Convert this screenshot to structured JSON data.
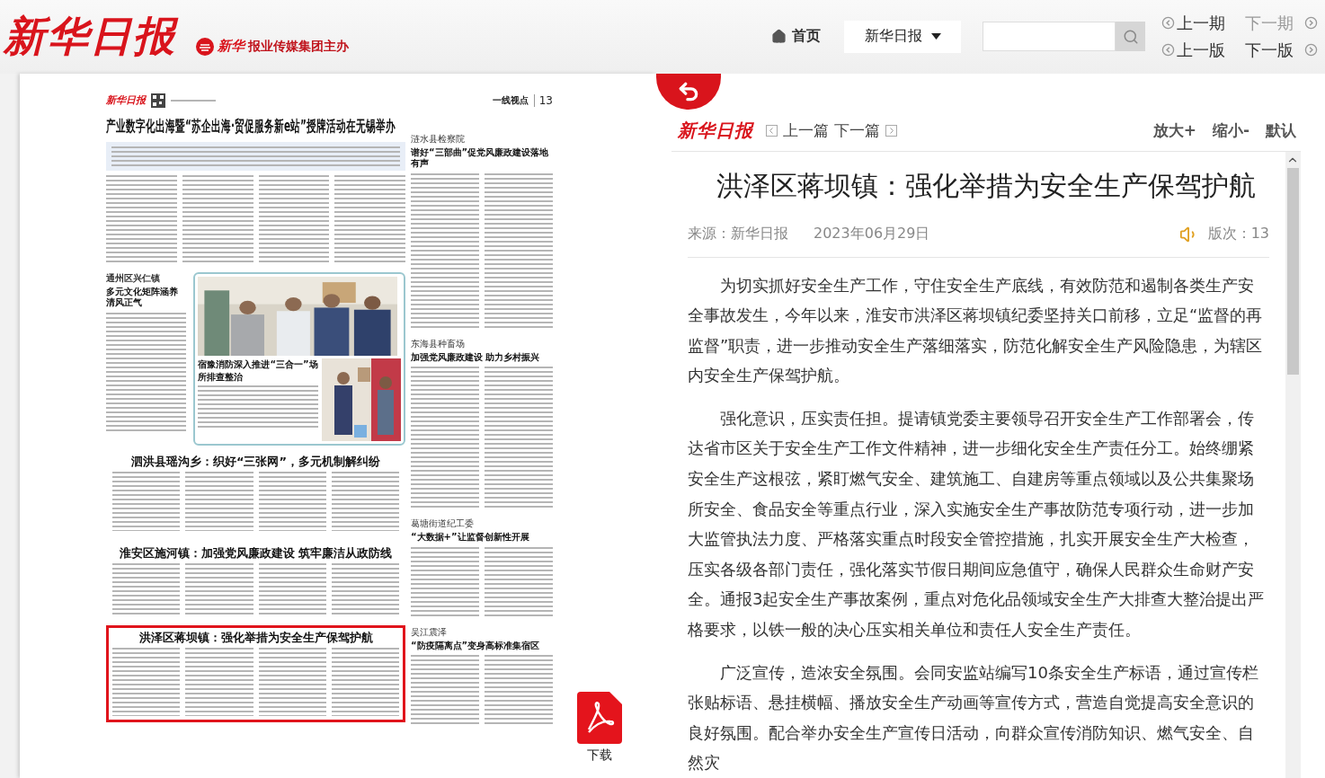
{
  "header": {
    "logo": "新华日报",
    "publisher_mark": "新华",
    "publisher": "报业传媒集团主办",
    "home": "首页",
    "edition_select": "新华日报",
    "issue_links": [
      {
        "label": "上一期",
        "kind": "prev",
        "disabled": false
      },
      {
        "label": "下一期",
        "kind": "next",
        "disabled": true
      },
      {
        "label": "上一版",
        "kind": "prev",
        "disabled": false
      },
      {
        "label": "下一版",
        "kind": "next",
        "disabled": false
      }
    ]
  },
  "newspaper_page": {
    "masthead": "新华日报",
    "section": "一线视点",
    "page_number": "13",
    "lead_headline": "产业数字化出海暨“苏企出海·贸促服务新e站”授牌活动在无锡举办",
    "side_story": {
      "kicker": "通州区兴仁镇",
      "headline": "多元文化矩阵涵养清风正气"
    },
    "photo_caption": "宿豫消防深入推进“三合一”场所排查整治",
    "stories": [
      {
        "headline": "泗洪县瑶沟乡：织好“三张网”，多元机制解纠纷",
        "highlighted": false
      },
      {
        "headline": "淮安区施河镇：加强党风廉政建设  筑牢廉洁从政防线",
        "highlighted": false
      },
      {
        "headline": "洪泽区蒋坝镇：强化举措为安全生产保驾护航",
        "highlighted": true
      }
    ],
    "right_column": [
      {
        "kicker": "涟水县检察院",
        "headline": "谱好“三部曲”促党风廉政建设落地有声"
      },
      {
        "kicker": "东海县种畜场",
        "headline": "加强党风廉政建设  助力乡村振兴"
      },
      {
        "kicker": "葛塘街道纪工委",
        "headline": "“大数据+”让监督创新性开展"
      },
      {
        "kicker": "吴江震泽",
        "headline": "“防疫隔离点”变身高标准集宿区"
      }
    ]
  },
  "download": "下载",
  "article": {
    "logo": "新华日报",
    "prev": "上一篇",
    "next": "下一篇",
    "zoom_in": "放大+",
    "zoom_out": "缩小-",
    "reset": "默认",
    "title": "洪泽区蒋坝镇：强化举措为安全生产保驾护航",
    "source": "来源：新华日报",
    "date": "2023年06月29日",
    "edition": "版次：13",
    "paragraphs": [
      "为切实抓好安全生产工作，守住安全生产底线，有效防范和遏制各类生产安全事故发生，今年以来，淮安市洪泽区蒋坝镇纪委坚持关口前移，立足“监督的再监督”职责，进一步推动安全生产落细落实，防范化解安全生产风险隐患，为辖区内安全生产保驾护航。",
      "强化意识，压实责任担。提请镇党委主要领导召开安全生产工作部署会，传达省市区关于安全生产工作文件精神，进一步细化安全生产责任分工。始终绷紧安全生产这根弦，紧盯燃气安全、建筑施工、自建房等重点领域以及公共集聚场所安全、食品安全等重点行业，深入实施安全生产事故防范专项行动，进一步加大监管执法力度、严格落实重点时段安全管控措施，扎实开展安全生产大检查，压实各级各部门责任，强化落实节假日期间应急值守，确保人民群众生命财产安全。通报3起安全生产事故案例，重点对危化品领域安全生产大排查大整治提出严格要求，以铁一般的决心压实相关单位和责任人安全生产责任。",
      "广泛宣传，造浓安全氛围。会同安监站编写10条安全生产标语，通过宣传栏张贴标语、悬挂横幅、播放安全生产动画等宣传方式，营造自觉提高安全意识的良好氛围。配合举办安全生产宣传日活动，向群众宣传消防知识、燃气安全、自然灾"
    ]
  }
}
